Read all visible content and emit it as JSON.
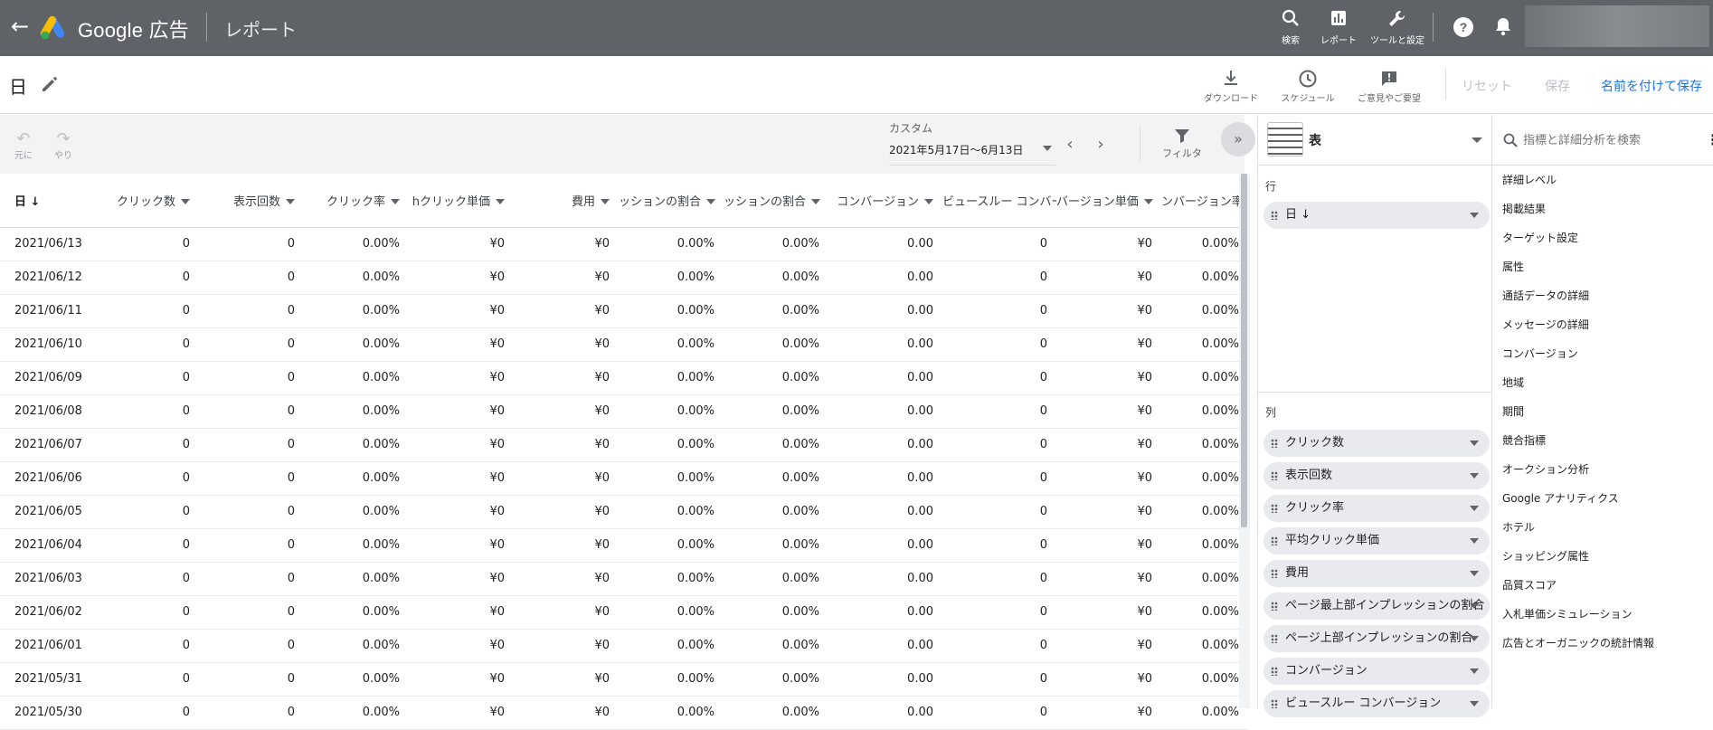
{
  "appbar": {
    "brand": "Google 広告",
    "section": "レポート",
    "nav": [
      {
        "label": "検索",
        "icon": "search-icon"
      },
      {
        "label": "レポート",
        "icon": "bar-chart-icon"
      },
      {
        "label": "ツールと設定",
        "icon": "wrench-icon"
      }
    ]
  },
  "toolbar": {
    "title": "日",
    "download": "ダウンロード",
    "schedule": "スケジュール",
    "feedback": "ご意見やご要望",
    "reset": "リセット",
    "save": "保存",
    "save_as": "名前を付けて保存"
  },
  "controls": {
    "undo": "元に",
    "redo": "やり",
    "date_label": "カスタム",
    "date_range": "2021年5月17日～6月13日",
    "filter": "フィルタ"
  },
  "table": {
    "columns": [
      "日",
      "クリック数",
      "表示回数",
      "クリック率",
      "平均クリック単価",
      "費用",
      "ページ最上部インプレッションの割合",
      "ページ上部インプレッションの割合",
      "コンバージョン",
      "ビュースルー コンバージョン",
      "コンバージョン単価",
      "コンバージョン率"
    ],
    "header_display": [
      "日",
      "クリック数",
      "表示回数",
      "クリック率",
      "hクリック単価",
      "費用",
      "ッションの割合",
      "ッションの割合",
      "コンバージョン",
      "ビュースルー コンバージョン",
      "バージョン単価",
      "ンバージョン率"
    ],
    "rows": [
      [
        "2021/06/13",
        "0",
        "0",
        "0.00%",
        "¥0",
        "¥0",
        "0.00%",
        "0.00%",
        "0.00",
        "0",
        "¥0",
        "0.00%"
      ],
      [
        "2021/06/12",
        "0",
        "0",
        "0.00%",
        "¥0",
        "¥0",
        "0.00%",
        "0.00%",
        "0.00",
        "0",
        "¥0",
        "0.00%"
      ],
      [
        "2021/06/11",
        "0",
        "0",
        "0.00%",
        "¥0",
        "¥0",
        "0.00%",
        "0.00%",
        "0.00",
        "0",
        "¥0",
        "0.00%"
      ],
      [
        "2021/06/10",
        "0",
        "0",
        "0.00%",
        "¥0",
        "¥0",
        "0.00%",
        "0.00%",
        "0.00",
        "0",
        "¥0",
        "0.00%"
      ],
      [
        "2021/06/09",
        "0",
        "0",
        "0.00%",
        "¥0",
        "¥0",
        "0.00%",
        "0.00%",
        "0.00",
        "0",
        "¥0",
        "0.00%"
      ],
      [
        "2021/06/08",
        "0",
        "0",
        "0.00%",
        "¥0",
        "¥0",
        "0.00%",
        "0.00%",
        "0.00",
        "0",
        "¥0",
        "0.00%"
      ],
      [
        "2021/06/07",
        "0",
        "0",
        "0.00%",
        "¥0",
        "¥0",
        "0.00%",
        "0.00%",
        "0.00",
        "0",
        "¥0",
        "0.00%"
      ],
      [
        "2021/06/06",
        "0",
        "0",
        "0.00%",
        "¥0",
        "¥0",
        "0.00%",
        "0.00%",
        "0.00",
        "0",
        "¥0",
        "0.00%"
      ],
      [
        "2021/06/05",
        "0",
        "0",
        "0.00%",
        "¥0",
        "¥0",
        "0.00%",
        "0.00%",
        "0.00",
        "0",
        "¥0",
        "0.00%"
      ],
      [
        "2021/06/04",
        "0",
        "0",
        "0.00%",
        "¥0",
        "¥0",
        "0.00%",
        "0.00%",
        "0.00",
        "0",
        "¥0",
        "0.00%"
      ],
      [
        "2021/06/03",
        "0",
        "0",
        "0.00%",
        "¥0",
        "¥0",
        "0.00%",
        "0.00%",
        "0.00",
        "0",
        "¥0",
        "0.00%"
      ],
      [
        "2021/06/02",
        "0",
        "0",
        "0.00%",
        "¥0",
        "¥0",
        "0.00%",
        "0.00%",
        "0.00",
        "0",
        "¥0",
        "0.00%"
      ],
      [
        "2021/06/01",
        "0",
        "0",
        "0.00%",
        "¥0",
        "¥0",
        "0.00%",
        "0.00%",
        "0.00",
        "0",
        "¥0",
        "0.00%"
      ],
      [
        "2021/05/31",
        "0",
        "0",
        "0.00%",
        "¥0",
        "¥0",
        "0.00%",
        "0.00%",
        "0.00",
        "0",
        "¥0",
        "0.00%"
      ],
      [
        "2021/05/30",
        "0",
        "0",
        "0.00%",
        "¥0",
        "¥0",
        "0.00%",
        "0.00%",
        "0.00",
        "0",
        "¥0",
        "0.00%"
      ]
    ]
  },
  "config": {
    "view": "表",
    "rows_label": "行",
    "row_items": [
      "日"
    ],
    "columns_label": "列",
    "column_items": [
      "クリック数",
      "表示回数",
      "クリック率",
      "平均クリック単価",
      "費用",
      "ページ最上部インプレッションの割合",
      "ページ上部インプレッションの割合",
      "コンバージョン",
      "ビュースルー コンバージョン"
    ]
  },
  "dimensions": {
    "search_placeholder": "指標と詳細分析を検索",
    "items": [
      "詳細レベル",
      "掲載結果",
      "ターゲット設定",
      "属性",
      "通話データの詳細",
      "メッセージの詳細",
      "コンバージョン",
      "地域",
      "期間",
      "競合指標",
      "オークション分析",
      "Google アナリティクス",
      "ホテル",
      "ショッピング属性",
      "品質スコア",
      "入札単価シミュレーション",
      "広告とオーガニックの統計情報"
    ]
  }
}
